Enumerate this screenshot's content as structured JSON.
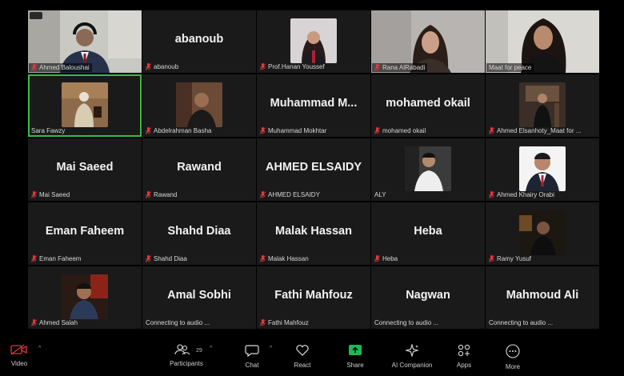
{
  "tiles": [
    {
      "big": "",
      "label": "Ahmed Baloushai",
      "video": true
    },
    {
      "big": "abanoub",
      "label": "abanoub",
      "video": false
    },
    {
      "big": "",
      "label": "Prof.Hanan Youssef",
      "video": true
    },
    {
      "big": "",
      "label": "Rana AlRabadi",
      "video": true
    },
    {
      "big": "",
      "label": "Maat for peace",
      "video": true
    },
    {
      "big": "",
      "label": "Sara Fawzy",
      "video": true
    },
    {
      "big": "",
      "label": "Abdelrahman Basha",
      "video": true
    },
    {
      "big": "Muhammad  M...",
      "label": "Muhammad Mokhtar",
      "video": false
    },
    {
      "big": "mohamed okail",
      "label": "mohamed okail",
      "video": false
    },
    {
      "big": "",
      "label": "Ahmed Elsanhoty_Maat for ...",
      "video": true
    },
    {
      "big": "Mai Saeed",
      "label": "Mai Saeed",
      "video": false
    },
    {
      "big": "Rawand",
      "label": "Rawand",
      "video": false
    },
    {
      "big": "AHMED ELSAIDY",
      "label": "AHMED ELSAIDY",
      "video": false
    },
    {
      "big": "",
      "label": "ALY",
      "video": true
    },
    {
      "big": "",
      "label": "Ahmed Khairy Orabi",
      "video": true
    },
    {
      "big": "Eman Faheem",
      "label": "Eman Faheem",
      "video": false
    },
    {
      "big": "Shahd Diaa",
      "label": "Shahd Diaa",
      "video": false
    },
    {
      "big": "Malak Hassan",
      "label": "Malak Hassan",
      "video": false
    },
    {
      "big": "Heba",
      "label": "Heba",
      "video": false
    },
    {
      "big": "",
      "label": "Ramy Yusuf",
      "video": true
    },
    {
      "big": "",
      "label": "Ahmed Salah",
      "video": true
    },
    {
      "big": "Amal Sobhi",
      "label": "Connecting to audio ...",
      "video": false
    },
    {
      "big": "Fathi Mahfouz",
      "label": "Fathi Mahfouz",
      "video": false
    },
    {
      "big": "Nagwan",
      "label": "Connecting to audio ...",
      "video": false
    },
    {
      "big": "Mahmoud Ali",
      "label": "Connecting to audio ...",
      "video": false
    }
  ],
  "toolbar": {
    "video": "Video",
    "participants": "Participants",
    "participants_count": "29",
    "chat": "Chat",
    "react": "React",
    "share": "Share",
    "ai_companion": "AI Companion",
    "apps": "Apps",
    "more": "More"
  },
  "colors": {
    "active_speaker": "#2fbf4f",
    "share_green": "#1db954",
    "muted_red": "#e0393e",
    "tile_bg": "#1a1a1a"
  }
}
